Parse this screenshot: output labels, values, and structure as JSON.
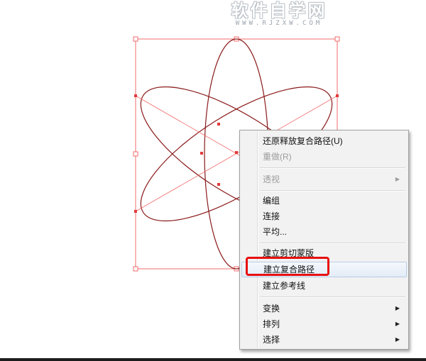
{
  "watermark": {
    "title": "软件自学网",
    "url": "WWW.RJZXW.COM"
  },
  "colors": {
    "path_stroke": "#8a1a1a",
    "selection": "#f26b6b",
    "highlight": "#e81010"
  },
  "context_menu": {
    "items": [
      {
        "label": "还原释放复合路径(U)",
        "disabled": false,
        "submenu": false
      },
      {
        "label": "重做(R)",
        "disabled": true,
        "submenu": false
      },
      {
        "label": "透视",
        "disabled": true,
        "submenu": true
      },
      {
        "label": "编组",
        "disabled": false,
        "submenu": false
      },
      {
        "label": "连接",
        "disabled": false,
        "submenu": false
      },
      {
        "label": "平均...",
        "disabled": false,
        "submenu": false
      },
      {
        "label": "建立剪切蒙版",
        "disabled": false,
        "submenu": false
      },
      {
        "label": "建立复合路径",
        "disabled": false,
        "submenu": false,
        "highlighted": true
      },
      {
        "label": "建立参考线",
        "disabled": false,
        "submenu": false
      },
      {
        "label": "变换",
        "disabled": false,
        "submenu": true
      },
      {
        "label": "排列",
        "disabled": false,
        "submenu": true
      },
      {
        "label": "选择",
        "disabled": false,
        "submenu": true
      }
    ]
  }
}
